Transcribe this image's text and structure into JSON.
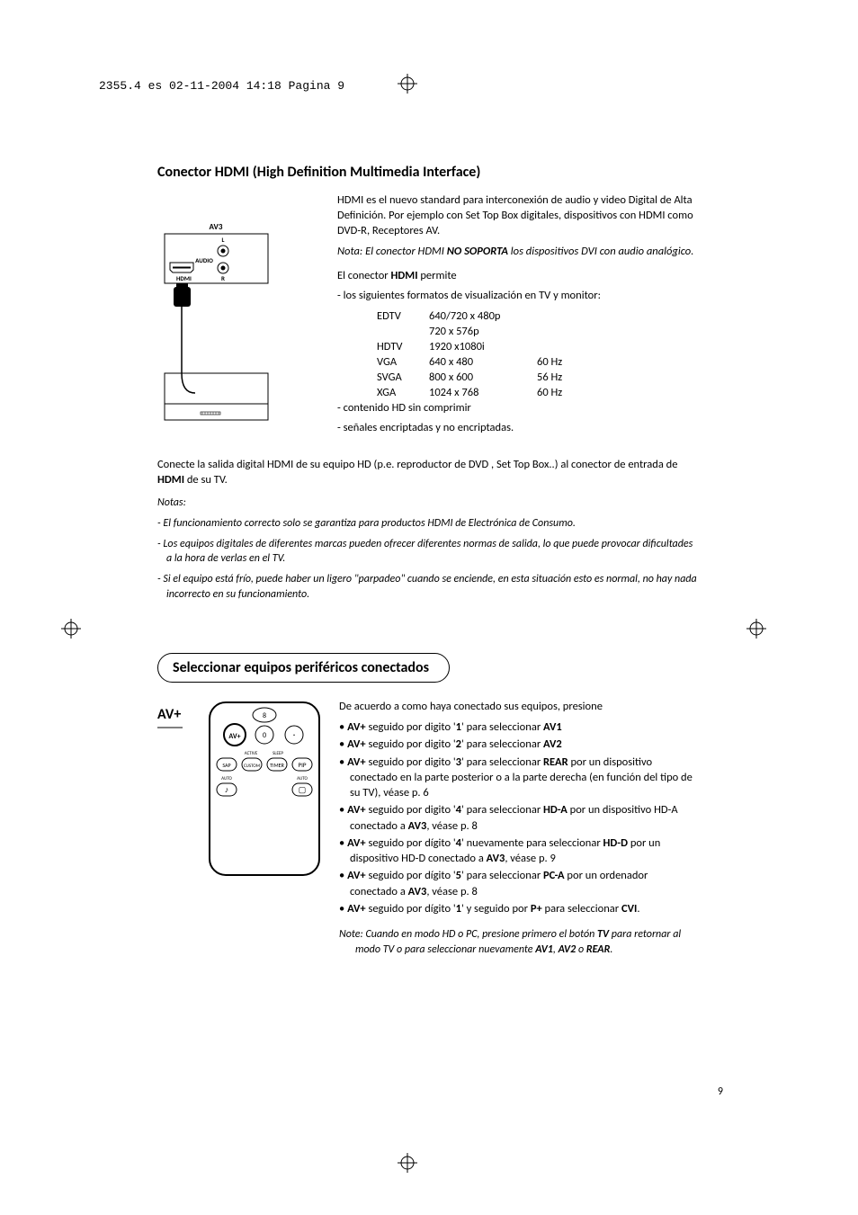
{
  "header": "2355.4 es  02-11-2004  14:18  Pagina 9",
  "section1": {
    "title": "Conector HDMI (High Definition Multimedia Interface)",
    "diagram": {
      "av3": "AV3",
      "l": "L",
      "audio": "AUDIO",
      "r": "R",
      "hdmi": "HDMI"
    },
    "intro": "HDMI es el nuevo standard para interconexión de audio y video Digital de Alta Definición. Por ejemplo con Set Top Box digitales, dispositivos con HDMI como DVD-R, Receptores AV.",
    "nota_pre": "Nota: El conector HDMI ",
    "nota_bold": "NO SOPORTA",
    "nota_post": " los dispositivos DVI con audio analógico.",
    "permite_pre": "El conector ",
    "permite_bold": "HDMI",
    "permite_post": " permite",
    "bullet1": "- los siguientes formatos de visualización en TV y monitor:",
    "formats": [
      {
        "c1": "EDTV",
        "c2": "640/720 x 480p",
        "c3": ""
      },
      {
        "c1": "",
        "c2": "720 x 576p",
        "c3": ""
      },
      {
        "c1": "HDTV",
        "c2": "1920 x1080i",
        "c3": ""
      },
      {
        "c1": "VGA",
        "c2": "640 x 480",
        "c3": "60 Hz"
      },
      {
        "c1": "SVGA",
        "c2": "800 x 600",
        "c3": "56 Hz"
      },
      {
        "c1": "XGA",
        "c2": "1024 x 768",
        "c3": "60 Hz"
      }
    ],
    "bullet2": "- contenido HD sin comprimir",
    "bullet3": "- señales encriptadas y no encriptadas.",
    "connect_pre": "Conecte la salida digital HDMI de su equipo HD (p.e. reproductor de DVD , Set Top Box..) al conector de entrada de ",
    "connect_bold": "HDMI",
    "connect_post": " de su TV.",
    "notas_title": "Notas:",
    "nota1": "- El funcionamiento correcto solo se garantiza para productos HDMI de Electrónica de Consumo.",
    "nota2": "- Los equipos digitales de diferentes marcas pueden ofrecer diferentes normas de salida, lo que puede provocar dificultades a la hora de verlas en el TV.",
    "nota3": "- Si el equipo está frío, puede haber un ligero \"parpadeo\" cuando se enciende, en esta situación esto es normal, no hay nada incorrecto en su funcionamiento."
  },
  "section2": {
    "title": "Seleccionar equipos periféricos conectados",
    "avplus": "AV+",
    "remote": {
      "b8": "8",
      "b0": "0",
      "bav": "AV+",
      "bdot": "·",
      "bsap": "SAP",
      "bcustom": "CUSTOM",
      "btimer": "TIMER",
      "bpip": "PIP",
      "lactive": "ACTIVE",
      "lsleep": "SLEEP",
      "lauto1": "AUTO",
      "lauto2": "AUTO",
      "bmusic": "♪",
      "btv": "▢"
    },
    "intro": "De acuerdo a como haya conectado sus equipos, presione",
    "items": [
      {
        "pre": "",
        "b1": "AV+",
        "mid1": " seguido por digito '",
        "b2": "1",
        "mid2": "' para seleccionar ",
        "b3": "AV1",
        "post": ""
      },
      {
        "pre": "",
        "b1": "AV+",
        "mid1": " seguido por digito '",
        "b2": "2",
        "mid2": "' para seleccionar ",
        "b3": "AV2",
        "post": ""
      },
      {
        "pre": "",
        "b1": "AV+",
        "mid1": " seguido por digito '",
        "b2": "3",
        "mid2": "' para seleccionar ",
        "b3": "REAR",
        "post": " por un dispositivo conectado en la parte posterior o a la parte derecha (en función del tipo de su TV), véase p. 6"
      },
      {
        "pre": "",
        "b1": "AV+",
        "mid1": " seguido por digito '",
        "b2": "4",
        "mid2": "' para seleccionar ",
        "b3": "HD-A",
        "post": " por un dispositivo HD-A conectado a ",
        "b4": "AV3",
        "post2": ", véase p. 8"
      },
      {
        "pre": "",
        "b1": "AV+",
        "mid1": " seguido por dígito '",
        "b2": "4",
        "mid2": "' nuevamente para seleccionar ",
        "b3": "HD-D",
        "post": " por un dispositivo HD-D conectado a ",
        "b4": "AV3",
        "post2": ", véase p. 9"
      },
      {
        "pre": "",
        "b1": "AV+",
        "mid1": " seguido por dígito '",
        "b2": "5",
        "mid2": "' para seleccionar ",
        "b3": "PC-A",
        "post": " por un ordenador conectado a ",
        "b4": "AV3",
        "post2": ", véase p. 8"
      },
      {
        "pre": "",
        "b1": "AV+",
        "mid1": " seguido por dígito '",
        "b2": "1",
        "mid2": "' y seguido por ",
        "b3": "P+",
        "post": " para seleccionar ",
        "b4": "CVI",
        "post2": "."
      }
    ],
    "note_pre": "Note: Cuando en modo HD o PC, presione primero el botón ",
    "note_b1": "TV",
    "note_mid": " para retornar al modo TV o para seleccionar nuevamente ",
    "note_b2": "AV1",
    "note_sep1": ", ",
    "note_b3": "AV2",
    "note_sep2": " o ",
    "note_b4": "REAR",
    "note_end": "."
  },
  "pagenum": "9"
}
